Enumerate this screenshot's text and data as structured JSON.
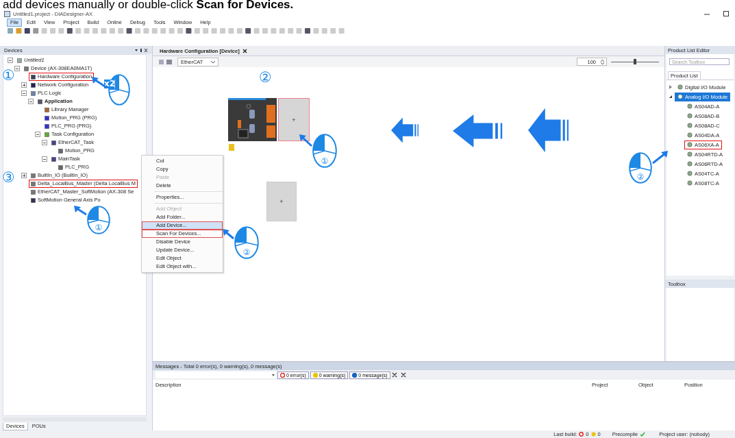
{
  "caption": "add devices manually or double-click **Scan for Devices.**",
  "window": {
    "title": "Untitled1.project - DIADesigner-AX"
  },
  "menu": [
    {
      "label": "File",
      "selected": true
    },
    {
      "label": "Edit",
      "selected": false
    },
    {
      "label": "View",
      "selected": false
    },
    {
      "label": "Project",
      "selected": false
    },
    {
      "label": "Build",
      "selected": false
    },
    {
      "label": "Online",
      "selected": false
    },
    {
      "label": "Debug",
      "selected": false
    },
    {
      "label": "Tools",
      "selected": false
    },
    {
      "label": "Window",
      "selected": false
    },
    {
      "label": "Help",
      "selected": false
    }
  ],
  "devices_panel": {
    "title": "Devices",
    "tree": [
      {
        "label": "Untitled1",
        "kind": "project",
        "expanded": true,
        "highlighted": false,
        "children": [
          {
            "label": "Device (AX-308EA0MA1T)",
            "kind": "device",
            "expanded": true,
            "highlighted": false,
            "children": [
              {
                "label": "Hardware Configuration",
                "kind": "config",
                "highlighted": true
              },
              {
                "label": "Network Configuration",
                "kind": "network",
                "expanded": false,
                "highlighted": false
              },
              {
                "label": "PLC Logic",
                "kind": "folder",
                "expanded": true,
                "highlighted": false,
                "children": [
                  {
                    "label": "Application",
                    "kind": "application",
                    "expanded": true,
                    "highlighted": false,
                    "children": [
                      {
                        "label": "Library Manager",
                        "kind": "library",
                        "highlighted": false
                      },
                      {
                        "label": "Motion_PRG (PRG)",
                        "kind": "program",
                        "highlighted": false
                      },
                      {
                        "label": "PLC_PRG (PRG)",
                        "kind": "program",
                        "highlighted": false
                      },
                      {
                        "label": "Task Configuration",
                        "kind": "tasks",
                        "expanded": true,
                        "highlighted": false,
                        "children": [
                          {
                            "label": "EtherCAT_Task",
                            "kind": "task",
                            "expanded": true,
                            "highlighted": false,
                            "children": [
                              {
                                "label": "Motion_PRG",
                                "kind": "call",
                                "highlighted": false
                              }
                            ]
                          },
                          {
                            "label": "MainTask",
                            "kind": "task",
                            "expanded": true,
                            "highlighted": false,
                            "children": [
                              {
                                "label": "PLC_PRG",
                                "kind": "call",
                                "highlighted": false
                              }
                            ]
                          }
                        ]
                      }
                    ]
                  }
                ]
              },
              {
                "label": "BuiltIn_IO (BuiltIn_IO)",
                "kind": "device",
                "expanded": false,
                "highlighted": false
              },
              {
                "label": "Delta_LocalBus_Master (Delta LocalBus M",
                "kind": "device",
                "highlighted": true
              },
              {
                "label": "EtherCAT_Master_SoftMotion (AX-308 Se",
                "kind": "device",
                "highlighted": false
              },
              {
                "label": "SoftMotion General Axis Po",
                "kind": "axis",
                "highlighted": false
              }
            ]
          }
        ]
      }
    ]
  },
  "bottom_tabs": [
    {
      "label": "Devices",
      "selected": true
    },
    {
      "label": "POUs",
      "selected": false
    }
  ],
  "context_menu": [
    {
      "kind": "item",
      "label": "Cut",
      "disabled": false,
      "selected": false,
      "highlighted": false
    },
    {
      "kind": "item",
      "label": "Copy",
      "disabled": false,
      "selected": false,
      "highlighted": false
    },
    {
      "kind": "item",
      "label": "Paste",
      "disabled": true,
      "selected": false,
      "highlighted": false
    },
    {
      "kind": "item",
      "label": "Delete",
      "disabled": false,
      "selected": false,
      "highlighted": false
    },
    {
      "kind": "separator"
    },
    {
      "kind": "item",
      "label": "Properties...",
      "disabled": false,
      "selected": false,
      "highlighted": false
    },
    {
      "kind": "separator"
    },
    {
      "kind": "item",
      "label": "Add Object",
      "disabled": true,
      "selected": false,
      "highlighted": false
    },
    {
      "kind": "item",
      "label": "Add Folder...",
      "disabled": false,
      "selected": false,
      "highlighted": false
    },
    {
      "kind": "item",
      "label": "Add Device...",
      "disabled": false,
      "selected": true,
      "highlighted": true
    },
    {
      "kind": "item",
      "label": "Scan For Devices...",
      "disabled": false,
      "selected": false,
      "highlighted": true
    },
    {
      "kind": "item",
      "label": "Disable Device",
      "disabled": false,
      "selected": false,
      "highlighted": false
    },
    {
      "kind": "item",
      "label": "Update Device...",
      "disabled": false,
      "selected": false,
      "highlighted": false
    },
    {
      "kind": "item",
      "label": "Edit Object",
      "disabled": false,
      "selected": false,
      "highlighted": false
    },
    {
      "kind": "item",
      "label": "Edit Object with...",
      "disabled": false,
      "selected": false,
      "highlighted": false
    }
  ],
  "editor": {
    "tab": "Hardware Configuration [Device]",
    "bus": "EtherCAT",
    "zoom": "100",
    "zoom_slider": {
      "level": 0.5
    },
    "slots": [
      {
        "label": "+",
        "highlighted": true
      },
      {
        "label": "+",
        "highlighted": false
      }
    ]
  },
  "product_list": {
    "title": "Product List Editor",
    "search_placeholder": "Search Toolbox",
    "tab": "Product List",
    "tree": [
      {
        "label": "Digital I/O Module",
        "expanded": false,
        "selected": false,
        "highlighted": false
      },
      {
        "label": "Analog I/O Module",
        "expanded": true,
        "selected": true,
        "highlighted": false,
        "children": [
          {
            "label": "AS04AD-A",
            "selected": false,
            "highlighted": false
          },
          {
            "label": "AS08AD-B",
            "selected": false,
            "highlighted": false
          },
          {
            "label": "AS08AD-C",
            "selected": false,
            "highlighted": false
          },
          {
            "label": "AS04DA-A",
            "selected": false,
            "highlighted": false
          },
          {
            "label": "AS06XA-A",
            "selected": false,
            "highlighted": true
          },
          {
            "label": "AS04RTD-A",
            "selected": false,
            "highlighted": false
          },
          {
            "label": "AS06RTD-A",
            "selected": false,
            "highlighted": false
          },
          {
            "label": "AS04TC-A",
            "selected": false,
            "highlighted": false
          },
          {
            "label": "AS08TC-A",
            "selected": false,
            "highlighted": false
          }
        ]
      }
    ]
  },
  "toolbox": {
    "title": "Toolbox"
  },
  "messages": {
    "title": "Messages - Total 0 error(s), 0 warning(s), 0 message(s)",
    "filters": [
      {
        "kind": "error",
        "label": "0 error(s)"
      },
      {
        "kind": "warning",
        "label": "0 warning(s)"
      },
      {
        "kind": "message",
        "label": "0 message(s)"
      }
    ],
    "columns": [
      "Description",
      "Project",
      "Object",
      "Position"
    ]
  },
  "status_bar": {
    "last_build": "Last build:",
    "errors": "0",
    "warnings": "0",
    "precompile": "Precompile",
    "user": "Project user: (nobody)"
  },
  "annotations": [
    {
      "kind": "step",
      "text": "①"
    },
    {
      "kind": "mouse",
      "text": "x2"
    },
    {
      "kind": "step",
      "text": "③"
    },
    {
      "kind": "mouse",
      "text": "①"
    },
    {
      "kind": "mouse",
      "text": "②"
    },
    {
      "kind": "step",
      "text": "②"
    },
    {
      "kind": "mouse",
      "text": "①"
    },
    {
      "kind": "mouse",
      "text": "②"
    }
  ]
}
